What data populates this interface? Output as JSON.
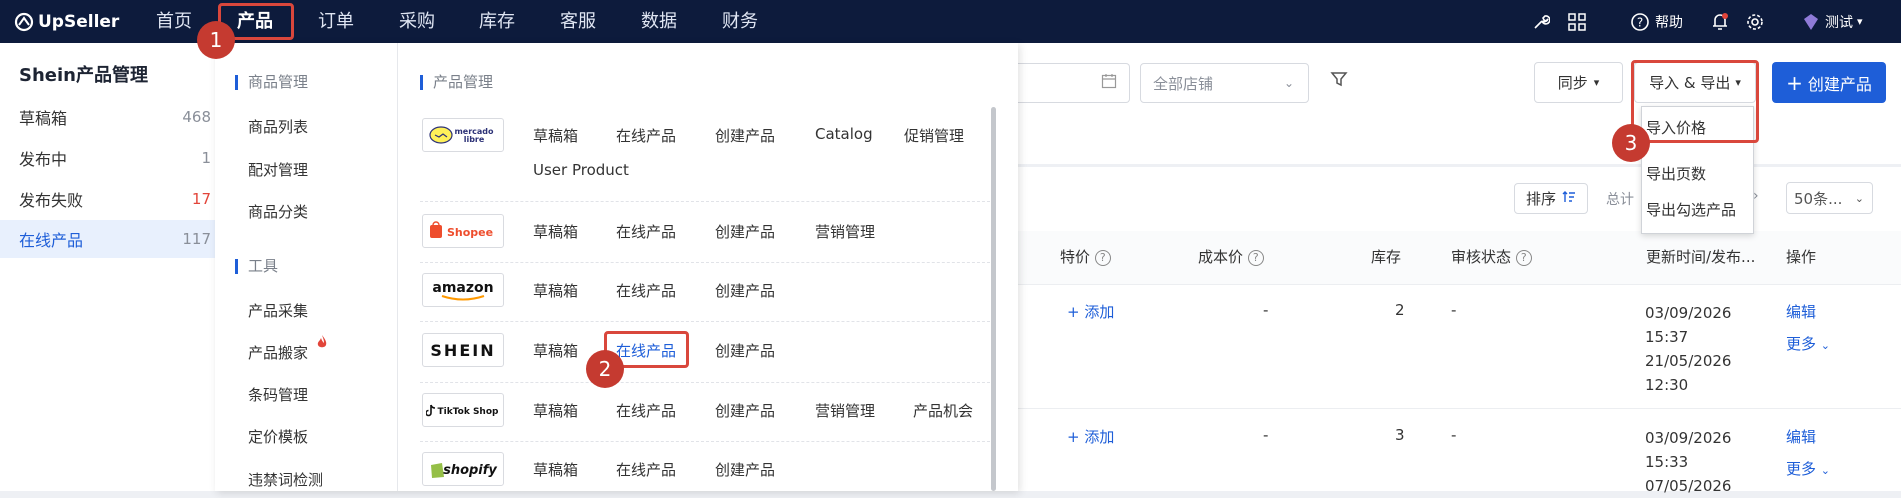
{
  "app": {
    "logo_text": "UpSeller",
    "brand_color": "#0d1b3c",
    "accent": "#1e5ed8",
    "highlight": "#d9473c"
  },
  "nav": {
    "items": [
      "首页",
      "产品",
      "订单",
      "采购",
      "库存",
      "客服",
      "数据",
      "财务"
    ],
    "active": "产品"
  },
  "topbar_right": {
    "help": "帮助",
    "user": "测试"
  },
  "sidebar": {
    "title": "Shein产品管理",
    "items": [
      {
        "label": "草稿箱",
        "count": "468"
      },
      {
        "label": "发布中",
        "count": "1"
      },
      {
        "label": "发布失败",
        "count": "17"
      },
      {
        "label": "在线产品",
        "count": "117"
      }
    ]
  },
  "toolbar": {
    "store_placeholder": "全部店铺",
    "sync": "同步",
    "import_export": "导入 & 导出",
    "create": "创建产品",
    "sort": "排序",
    "total": "总计",
    "page_size": "50条..."
  },
  "import_export_menu": [
    "导入价格",
    "导出页数",
    "导出勾选产品"
  ],
  "table": {
    "headers": [
      "特价",
      "成本价",
      "库存",
      "审核状态",
      "更新时间/发布...",
      "操作"
    ],
    "rows": [
      {
        "special": "+ 添加",
        "cost": "-",
        "stock": "2",
        "status": "-",
        "updated": "03/09/2026",
        "updated_time": "15:37",
        "published": "21/05/2026",
        "published_time": "12:30",
        "edit": "编辑",
        "more": "更多"
      },
      {
        "special": "+ 添加",
        "cost": "-",
        "stock": "3",
        "status": "-",
        "updated": "03/09/2026",
        "updated_time": "15:33",
        "published": "07/05/2026",
        "edit": "编辑",
        "more": "更多"
      }
    ]
  },
  "mega_menu": {
    "left_groups": [
      {
        "title": "商品管理",
        "items": [
          "商品列表",
          "配对管理",
          "商品分类"
        ]
      },
      {
        "title": "工具",
        "items": [
          "产品采集",
          "产品搬家",
          "条码管理",
          "定价模板",
          "违禁词检测"
        ]
      }
    ],
    "right_title": "产品管理",
    "platforms": [
      {
        "name": "mercado libre",
        "links": [
          "草稿箱",
          "在线产品",
          "创建产品",
          "Catalog",
          "促销管理",
          "User Product"
        ]
      },
      {
        "name": "Shopee",
        "links": [
          "草稿箱",
          "在线产品",
          "创建产品",
          "营销管理"
        ]
      },
      {
        "name": "amazon",
        "links": [
          "草稿箱",
          "在线产品",
          "创建产品"
        ]
      },
      {
        "name": "SHEIN",
        "links": [
          "草稿箱",
          "在线产品",
          "创建产品"
        ]
      },
      {
        "name": "TikTok Shop",
        "links": [
          "草稿箱",
          "在线产品",
          "创建产品",
          "营销管理",
          "产品机会"
        ]
      },
      {
        "name": "shopify",
        "links": [
          "草稿箱",
          "在线产品",
          "创建产品"
        ]
      }
    ]
  },
  "step_badges": [
    "1",
    "2",
    "3"
  ]
}
